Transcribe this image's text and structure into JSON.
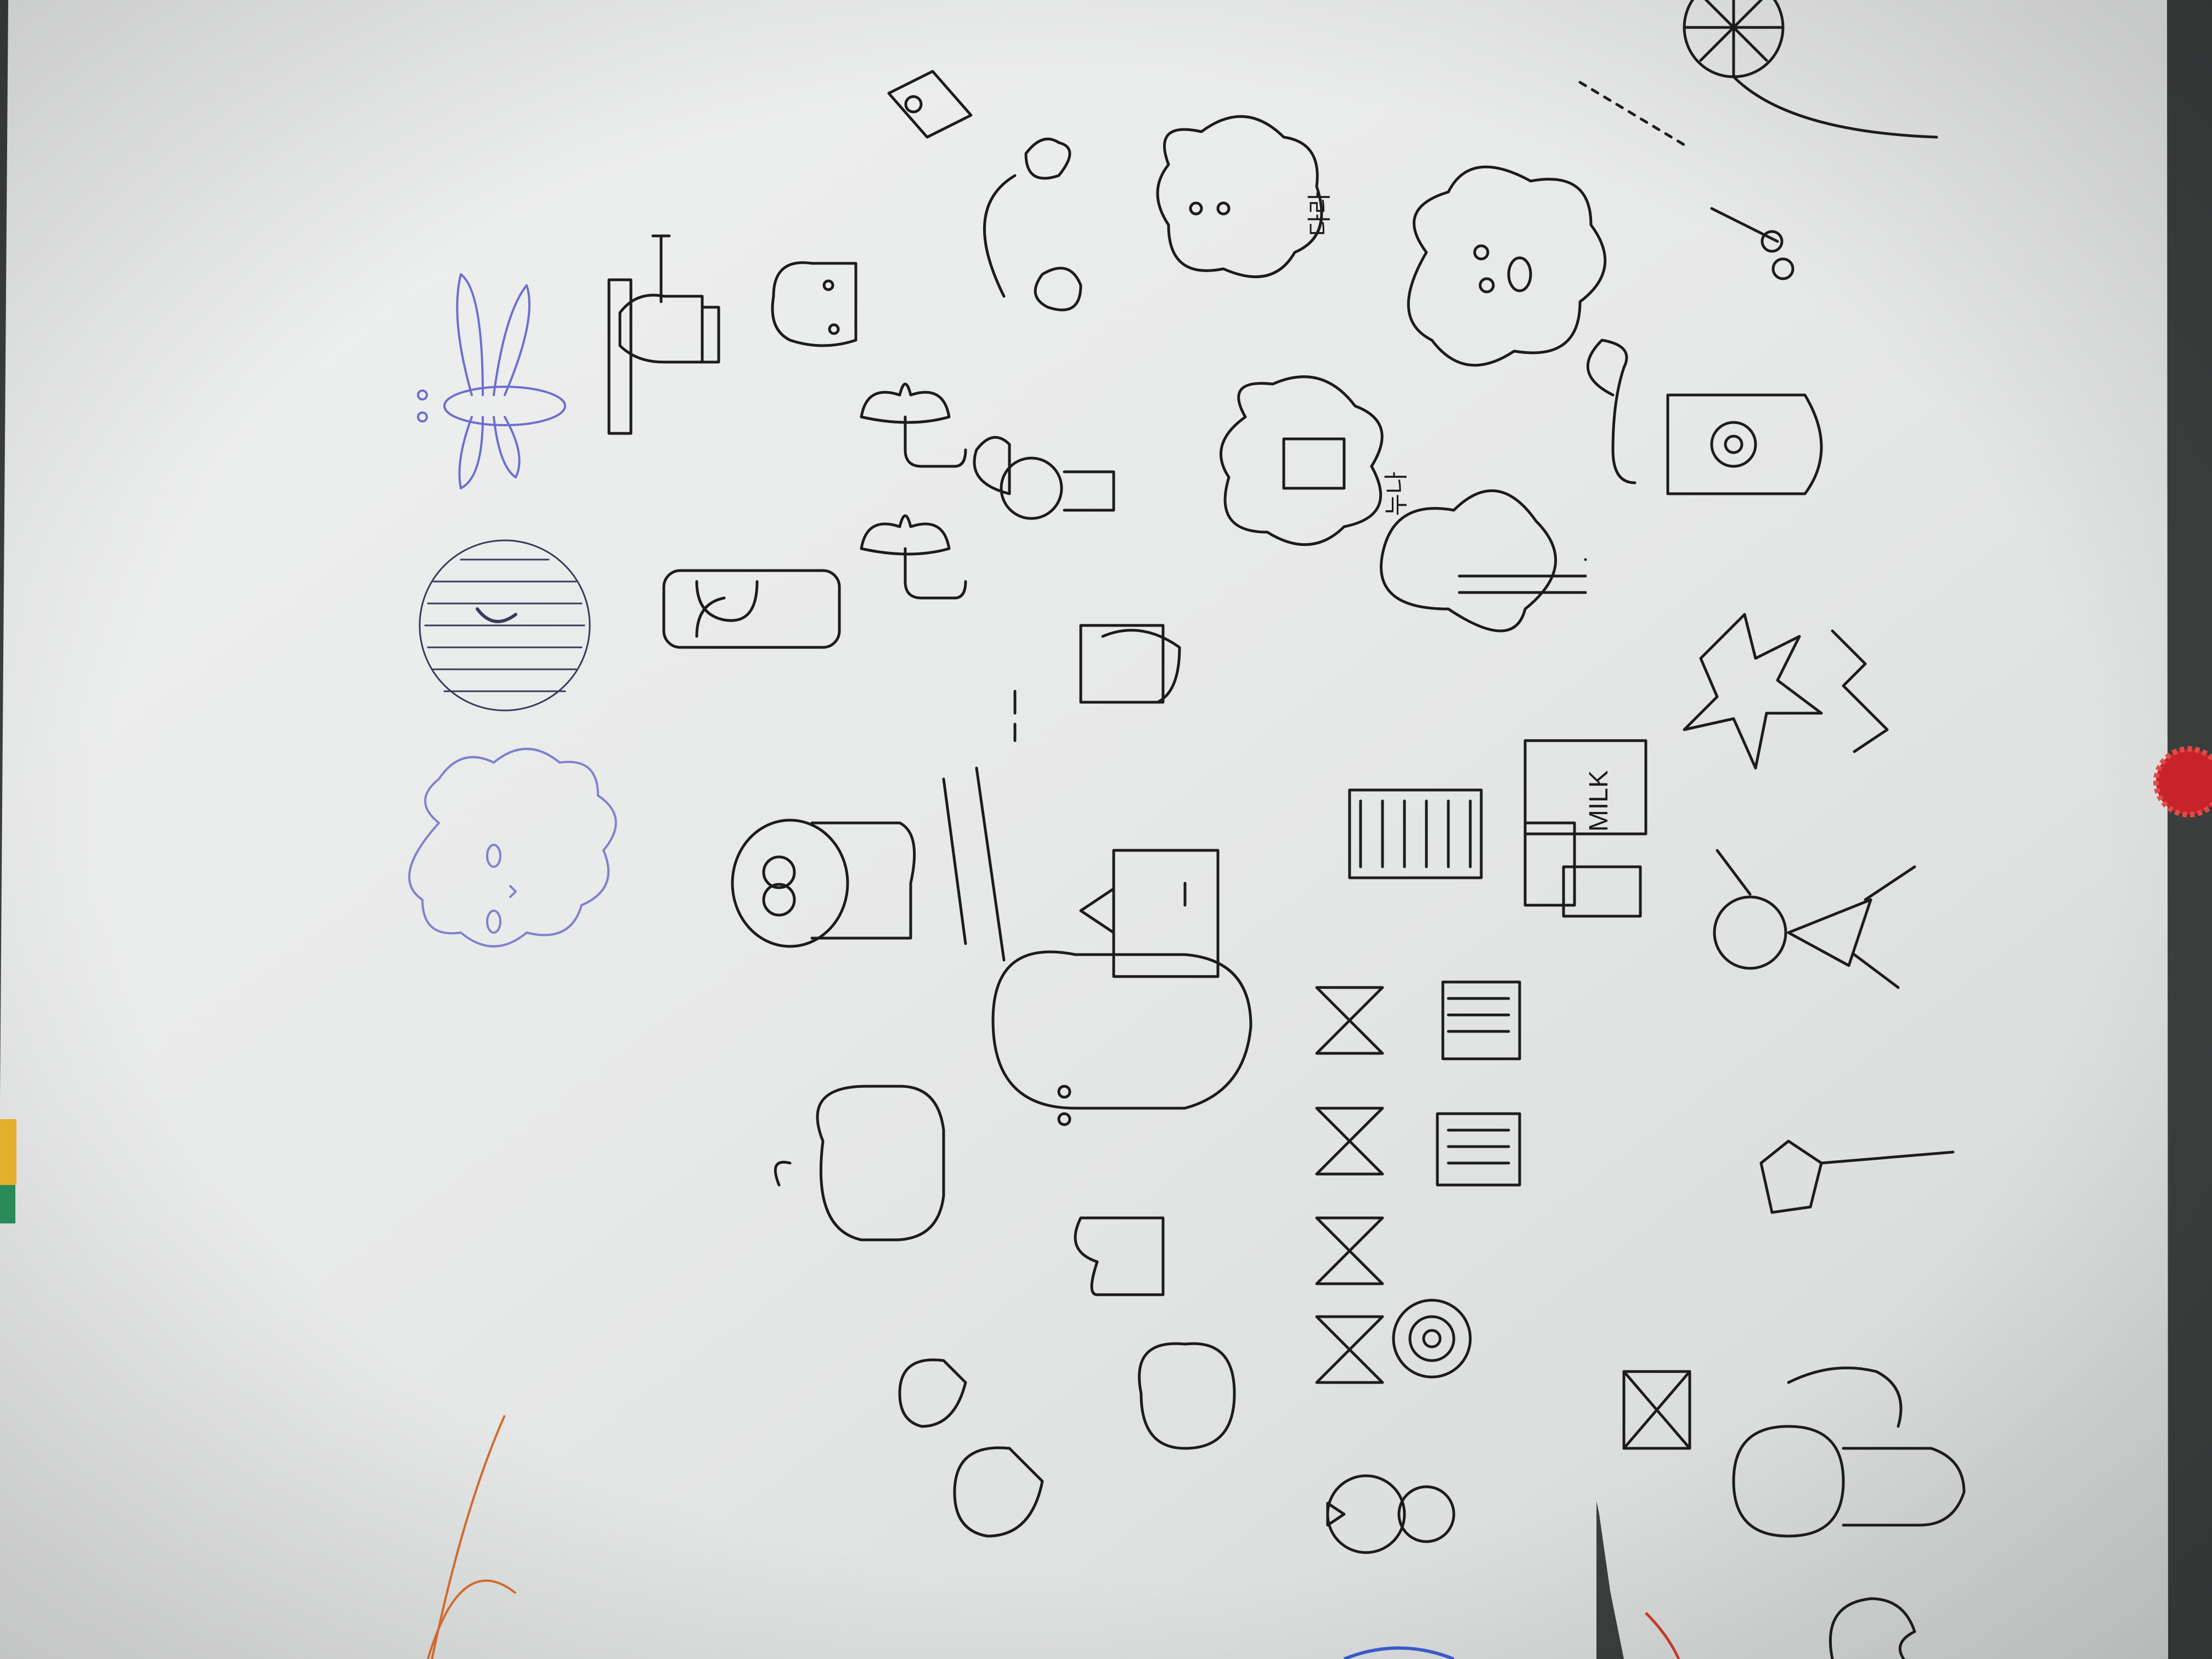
{
  "photo": {
    "subject": "doodles",
    "orientation": "rotated",
    "paper_color": "#e9eaea",
    "table_color": "#3b3f3e",
    "ink_color": "#1c1c1c",
    "blue_ink_color": "#5a5fc8",
    "orange_ink_color": "#d06a2a",
    "red_ink_color": "#c23a2a",
    "sticker_color": "#c8232b"
  },
  "doodles": {
    "milk_label": "MILK",
    "korean_label_1": "다라",
    "korean_label_2": "누나"
  }
}
